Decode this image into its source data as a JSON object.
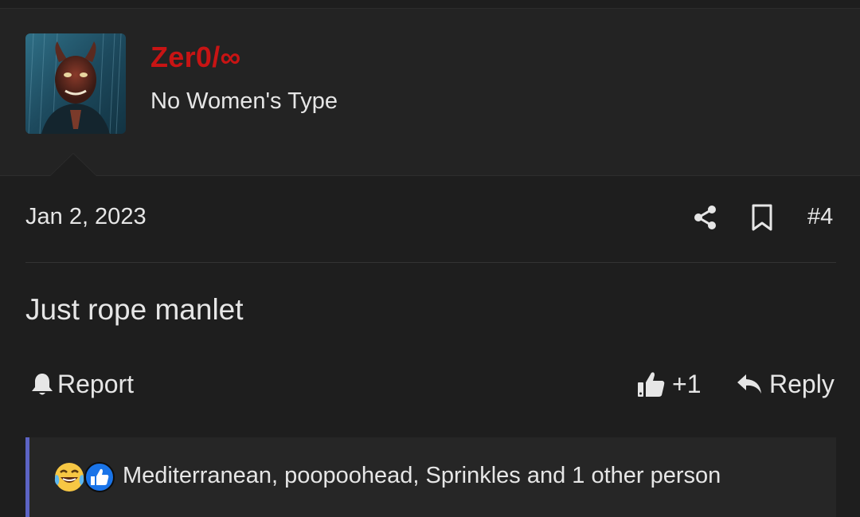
{
  "user": {
    "name": "Zer0/∞",
    "title": "No Women's Type"
  },
  "post": {
    "date": "Jan 2, 2023",
    "number": "#4",
    "body": "Just rope manlet"
  },
  "actions": {
    "report_label": "Report",
    "like_count": "+1",
    "reply_label": "Reply"
  },
  "reactions": {
    "summary": "Mediterranean, poopoohead, Sprinkles and 1 other person",
    "icons": [
      "laughing-crying-emoji",
      "thumbs-up-reaction"
    ]
  },
  "colors": {
    "username": "#c81414",
    "reaction_accent": "#5c63c4",
    "background": "#1e1e1e"
  }
}
